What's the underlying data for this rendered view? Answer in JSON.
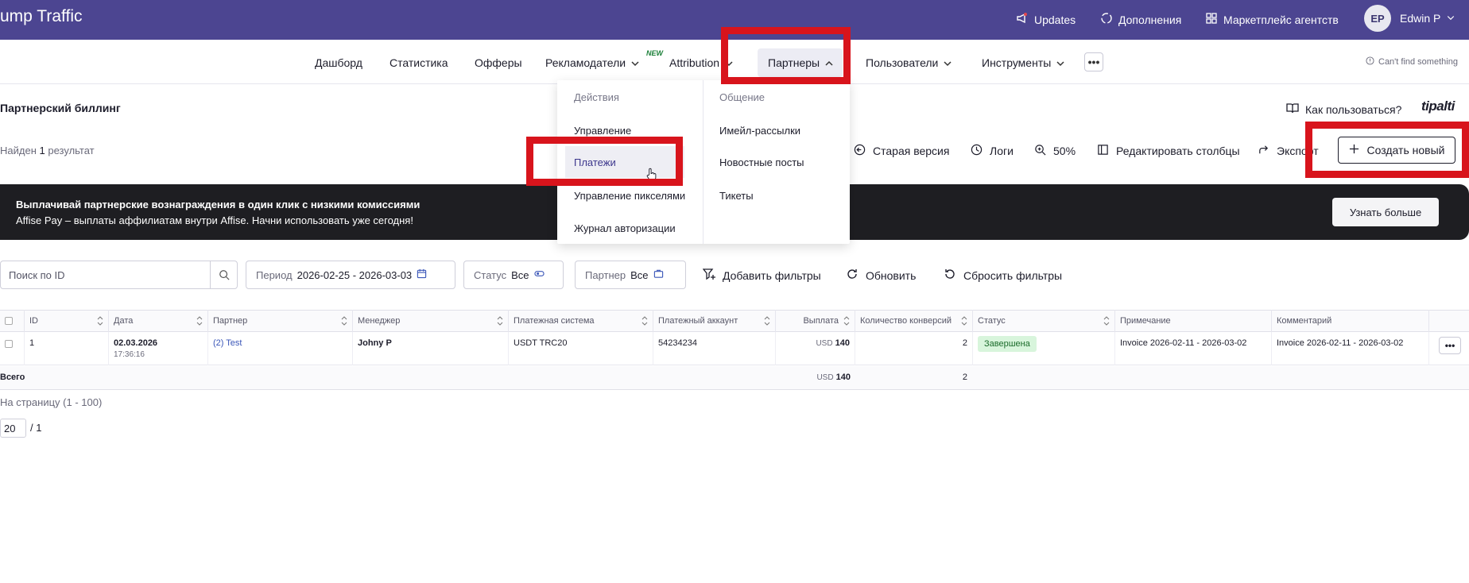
{
  "topbar": {
    "brand": "ump Traffic",
    "updates": "Updates",
    "addons": "Дополнения",
    "marketplace": "Маркетплейс агентств",
    "avatar_initials": "EP",
    "user_name": "Edwin P"
  },
  "nav": {
    "items": [
      "Дашборд",
      "Статистика",
      "Офферы",
      "Рекламодатели",
      "Attribution",
      "Партнеры",
      "Пользователи",
      "Инструменты"
    ],
    "new_tag": "NEW",
    "more": "•••",
    "cant_find": "Can't find something"
  },
  "dropdown": {
    "col1_head": "Действия",
    "col1_items": [
      "Управление",
      "Платежи",
      "Управление пикселями",
      "Журнал авторизации"
    ],
    "col2_head": "Общение",
    "col2_items": [
      "Имейл-рассылки",
      "Новостные посты",
      "Тикеты"
    ]
  },
  "page": {
    "title": "Партнерский биллинг",
    "how_to_use": "Как пользоваться?",
    "tipalti": "tipalti",
    "found_prefix": "Найден",
    "found_count": "1",
    "found_suffix": "результат"
  },
  "toolbar": {
    "old_version": "Старая версия",
    "logs": "Логи",
    "zoom": "50%",
    "edit_columns": "Редактировать столбцы",
    "export": "Экспорт",
    "create_new": "Создать новый"
  },
  "banner": {
    "title": "Выплачивай партнерские вознаграждения в один клик с низкими комиссиями",
    "subtitle": "Affise Pay – выплаты аффилиатам внутри Affise. Начни использовать уже сегодня!",
    "button": "Узнать больше"
  },
  "filters": {
    "search_placeholder": "Поиск по ID",
    "period_label": "Период",
    "period_value": "2026-02-25 - 2026-03-03",
    "status_label": "Статус",
    "status_value": "Все",
    "partner_label": "Партнер",
    "partner_value": "Все",
    "add_filters": "Добавить фильтры",
    "refresh": "Обновить",
    "reset": "Сбросить фильтры"
  },
  "table": {
    "headers": [
      "ID",
      "Дата",
      "Партнер",
      "Менеджер",
      "Платежная система",
      "Платежный аккаунт",
      "Выплата",
      "Количество конверсий",
      "Статус",
      "Примечание",
      "Комментарий"
    ],
    "row": {
      "id": "1",
      "date": "02.03.2026",
      "time": "17:36:16",
      "partner": "(2) Test",
      "manager": "Johny P",
      "payment_system": "USDT TRC20",
      "payment_account": "54234234",
      "payout_currency": "USD",
      "payout_value": "140",
      "conversions": "2",
      "status": "Завершена",
      "note": "Invoice 2026-02-11 - 2026-03-02",
      "comment": "Invoice 2026-02-11 - 2026-03-02"
    },
    "total": {
      "label": "Всего",
      "payout_currency": "USD",
      "payout_value": "140",
      "conversions": "2"
    },
    "row_more": "•••"
  },
  "pagination": {
    "per_page": "На страницу (1 - 100)",
    "page_value": "20",
    "page_total": "/ 1"
  },
  "colors": {
    "topbar": "#4c4591",
    "highlight": "#d8141c",
    "banner": "#1e1e22"
  }
}
